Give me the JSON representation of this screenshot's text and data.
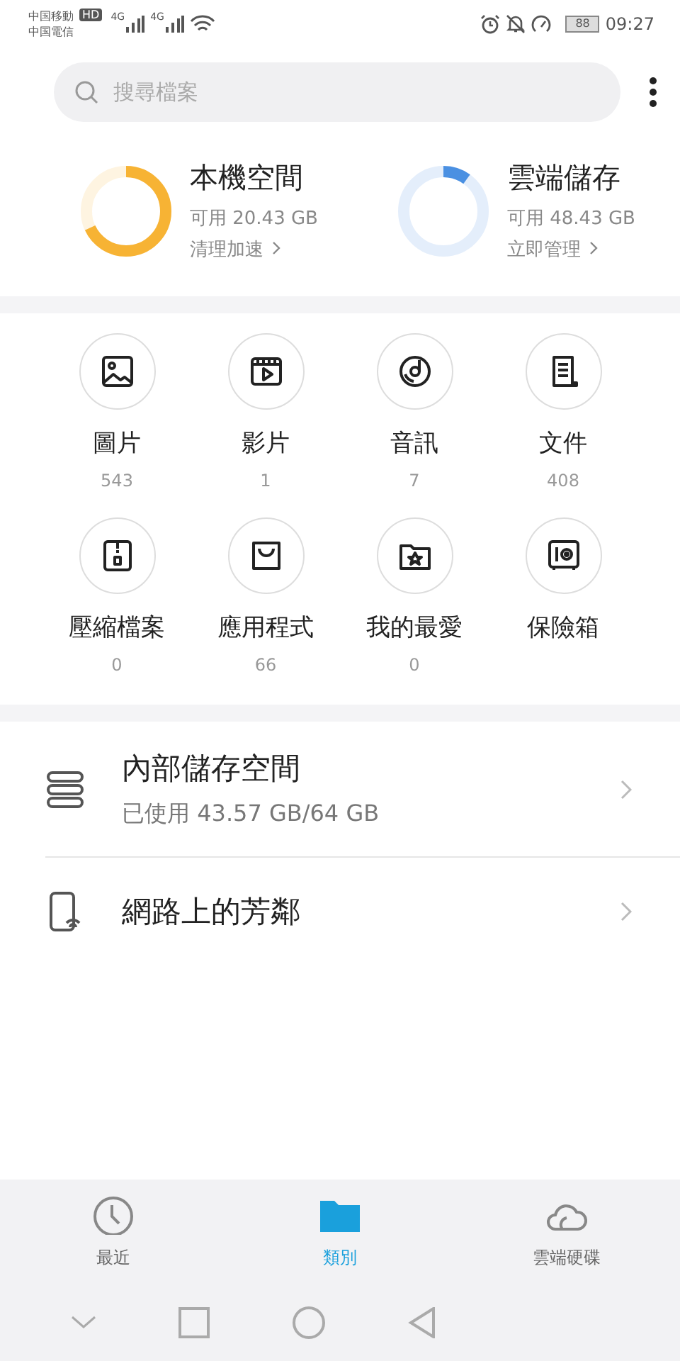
{
  "status_bar": {
    "carriers": [
      "中国移動",
      "中国電信"
    ],
    "hd": "HD",
    "networks": [
      "4G",
      "4G"
    ],
    "battery": "88",
    "time": "09:27"
  },
  "search": {
    "placeholder": "搜尋檔案"
  },
  "storage": [
    {
      "title": "本機空間",
      "available": "可用 20.43 GB",
      "action": "清理加速",
      "level": 0.68,
      "color": "#f7b334"
    },
    {
      "title": "雲端儲存",
      "available": "可用 48.43 GB",
      "action": "立即管理",
      "level": 0.1,
      "color": "#4a90e2"
    }
  ],
  "categories": [
    {
      "label": "圖片",
      "count": "543"
    },
    {
      "label": "影片",
      "count": "1"
    },
    {
      "label": "音訊",
      "count": "7"
    },
    {
      "label": "文件",
      "count": "408"
    },
    {
      "label": "壓縮檔案",
      "count": "0"
    },
    {
      "label": "應用程式",
      "count": "66"
    },
    {
      "label": "我的最愛",
      "count": "0"
    },
    {
      "label": "保險箱"
    }
  ],
  "locations": [
    {
      "title": "內部儲存空間",
      "subtitle": "已使用 43.57 GB/64 GB"
    },
    {
      "title": "網路上的芳鄰"
    }
  ],
  "tabs": [
    {
      "label": "最近",
      "selected": false
    },
    {
      "label": "類別",
      "selected": true
    },
    {
      "label": "雲端硬碟",
      "selected": false
    }
  ]
}
